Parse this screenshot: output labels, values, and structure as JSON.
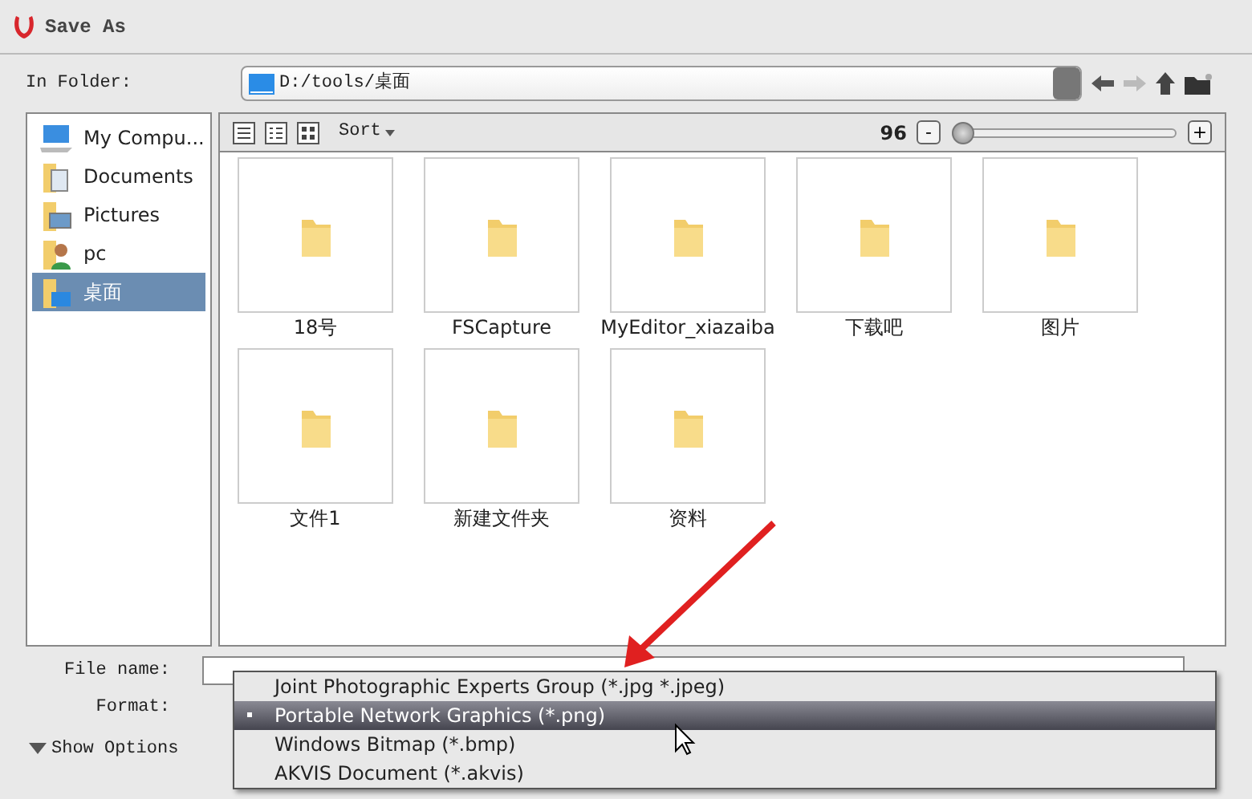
{
  "window": {
    "title": "Save As"
  },
  "folder_bar": {
    "label": "In Folder:",
    "path": "D:/tools/桌面"
  },
  "sidebar": {
    "items": [
      {
        "label": "My Compu...",
        "kind": "computer",
        "selected": false
      },
      {
        "label": "Documents",
        "kind": "documents",
        "selected": false
      },
      {
        "label": "Pictures",
        "kind": "pictures",
        "selected": false
      },
      {
        "label": "pc",
        "kind": "user",
        "selected": false
      },
      {
        "label": "桌面",
        "kind": "desktop",
        "selected": true
      }
    ]
  },
  "toolbar": {
    "sort": "Sort",
    "zoom": "96",
    "zoom_out": "-",
    "zoom_in": "+",
    "level": 0.0
  },
  "files": [
    "18号",
    "FSCapture",
    "MyEditor_xiazaiba",
    "下载吧",
    "图片",
    "文件1",
    "新建文件夹",
    "资料"
  ],
  "form": {
    "file_name_label": "File name:",
    "format_label": "Format:",
    "show_options": "Show Options"
  },
  "format_menu": {
    "items": [
      {
        "label": "Joint Photographic Experts Group (*.jpg *.jpeg)",
        "selected": false
      },
      {
        "label": "Portable Network Graphics (*.png)",
        "selected": true
      },
      {
        "label": "Windows Bitmap (*.bmp)",
        "selected": false
      },
      {
        "label": "AKVIS Document (*.akvis)",
        "selected": false
      }
    ]
  }
}
